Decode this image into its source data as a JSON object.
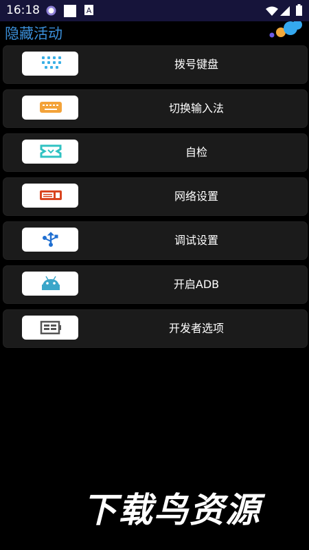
{
  "status_bar": {
    "time": "16:18",
    "icons": [
      "notification-circle-icon",
      "square-icon",
      "a-badge-icon",
      "wifi-icon",
      "signal-icon",
      "battery-icon"
    ]
  },
  "title_bar": {
    "title": "隐藏活动"
  },
  "menu": {
    "items": [
      {
        "label": "拨号键盘",
        "icon": "dialpad-icon"
      },
      {
        "label": "切换输入法",
        "icon": "keyboard-icon"
      },
      {
        "label": "自检",
        "icon": "self-check-icon"
      },
      {
        "label": "网络设置",
        "icon": "network-icon"
      },
      {
        "label": "调试设置",
        "icon": "usb-debug-icon"
      },
      {
        "label": "开启ADB",
        "icon": "android-icon"
      },
      {
        "label": "开发者选项",
        "icon": "developer-icon"
      }
    ]
  },
  "watermark": "下载鸟资源",
  "colors": {
    "status_bar_bg": "#16143a",
    "title_color": "#3b8fd9",
    "item_bg": "#1b1b1b"
  }
}
